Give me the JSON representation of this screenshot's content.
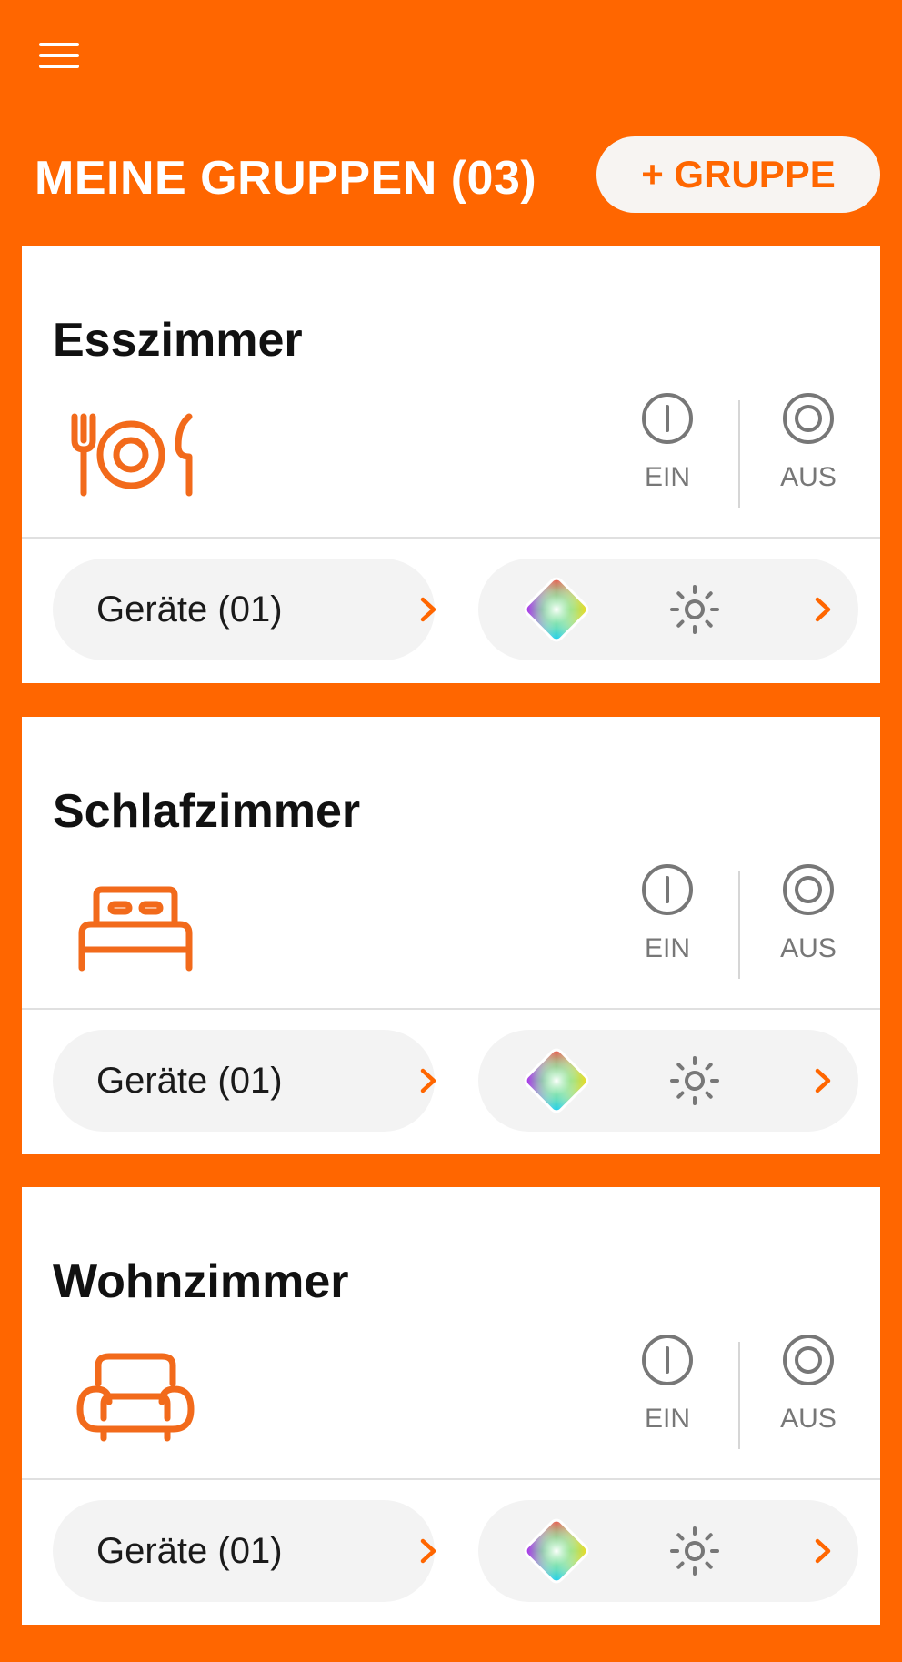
{
  "header": {
    "title": "MEINE GRUPPEN (03)",
    "add_button_label": "+ GRUPPE"
  },
  "colors": {
    "brand": "#FF6600",
    "card_background": "#FFFFFF",
    "pill_background": "#F3F3F3",
    "control_gray": "#777777"
  },
  "groups": [
    {
      "name": "Esszimmer",
      "icon": "dining-icon",
      "on_label": "EIN",
      "off_label": "AUS",
      "devices_label": "Geräte (01)",
      "color_icon": "rgb-color-icon",
      "brightness_icon": "brightness-icon"
    },
    {
      "name": "Schlafzimmer",
      "icon": "bed-icon",
      "on_label": "EIN",
      "off_label": "AUS",
      "devices_label": "Geräte (01)",
      "color_icon": "rgb-color-icon",
      "brightness_icon": "brightness-icon"
    },
    {
      "name": "Wohnzimmer",
      "icon": "armchair-icon",
      "on_label": "EIN",
      "off_label": "AUS",
      "devices_label": "Geräte (01)",
      "color_icon": "rgb-color-icon",
      "brightness_icon": "brightness-icon"
    }
  ]
}
